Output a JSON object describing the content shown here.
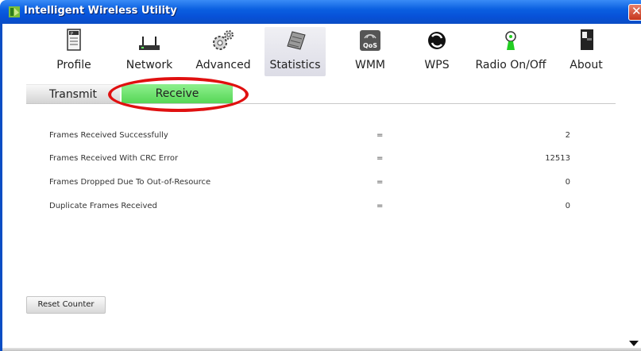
{
  "window": {
    "title": "Intelligent Wireless Utility",
    "close_label": "✕"
  },
  "toolbar": {
    "items": [
      {
        "label": "Profile",
        "icon": "profile-icon"
      },
      {
        "label": "Network",
        "icon": "network-icon"
      },
      {
        "label": "Advanced",
        "icon": "advanced-icon"
      },
      {
        "label": "Statistics",
        "icon": "statistics-icon",
        "active": true
      },
      {
        "label": "WMM",
        "icon": "wmm-qos-icon",
        "badge": "QoS"
      },
      {
        "label": "WPS",
        "icon": "wps-icon"
      },
      {
        "label": "Radio On/Off",
        "icon": "radio-icon"
      },
      {
        "label": "About",
        "icon": "about-icon"
      }
    ]
  },
  "tabs": {
    "transmit": "Transmit",
    "receive": "Receive",
    "active": "receive"
  },
  "stats": {
    "rows": [
      {
        "name": "Frames Received Successfully",
        "sep": "=",
        "value": "2"
      },
      {
        "name": "Frames Received With CRC Error",
        "sep": "=",
        "value": "12513"
      },
      {
        "name": "Frames Dropped Due To Out-of-Resource",
        "sep": "=",
        "value": "0"
      },
      {
        "name": "Duplicate Frames Received",
        "sep": "=",
        "value": "0"
      }
    ]
  },
  "actions": {
    "reset_label": "Reset Counter"
  },
  "colors": {
    "titlebar": "#0a5fe0",
    "active_tab": "#56d656",
    "highlight": "#e01010"
  }
}
